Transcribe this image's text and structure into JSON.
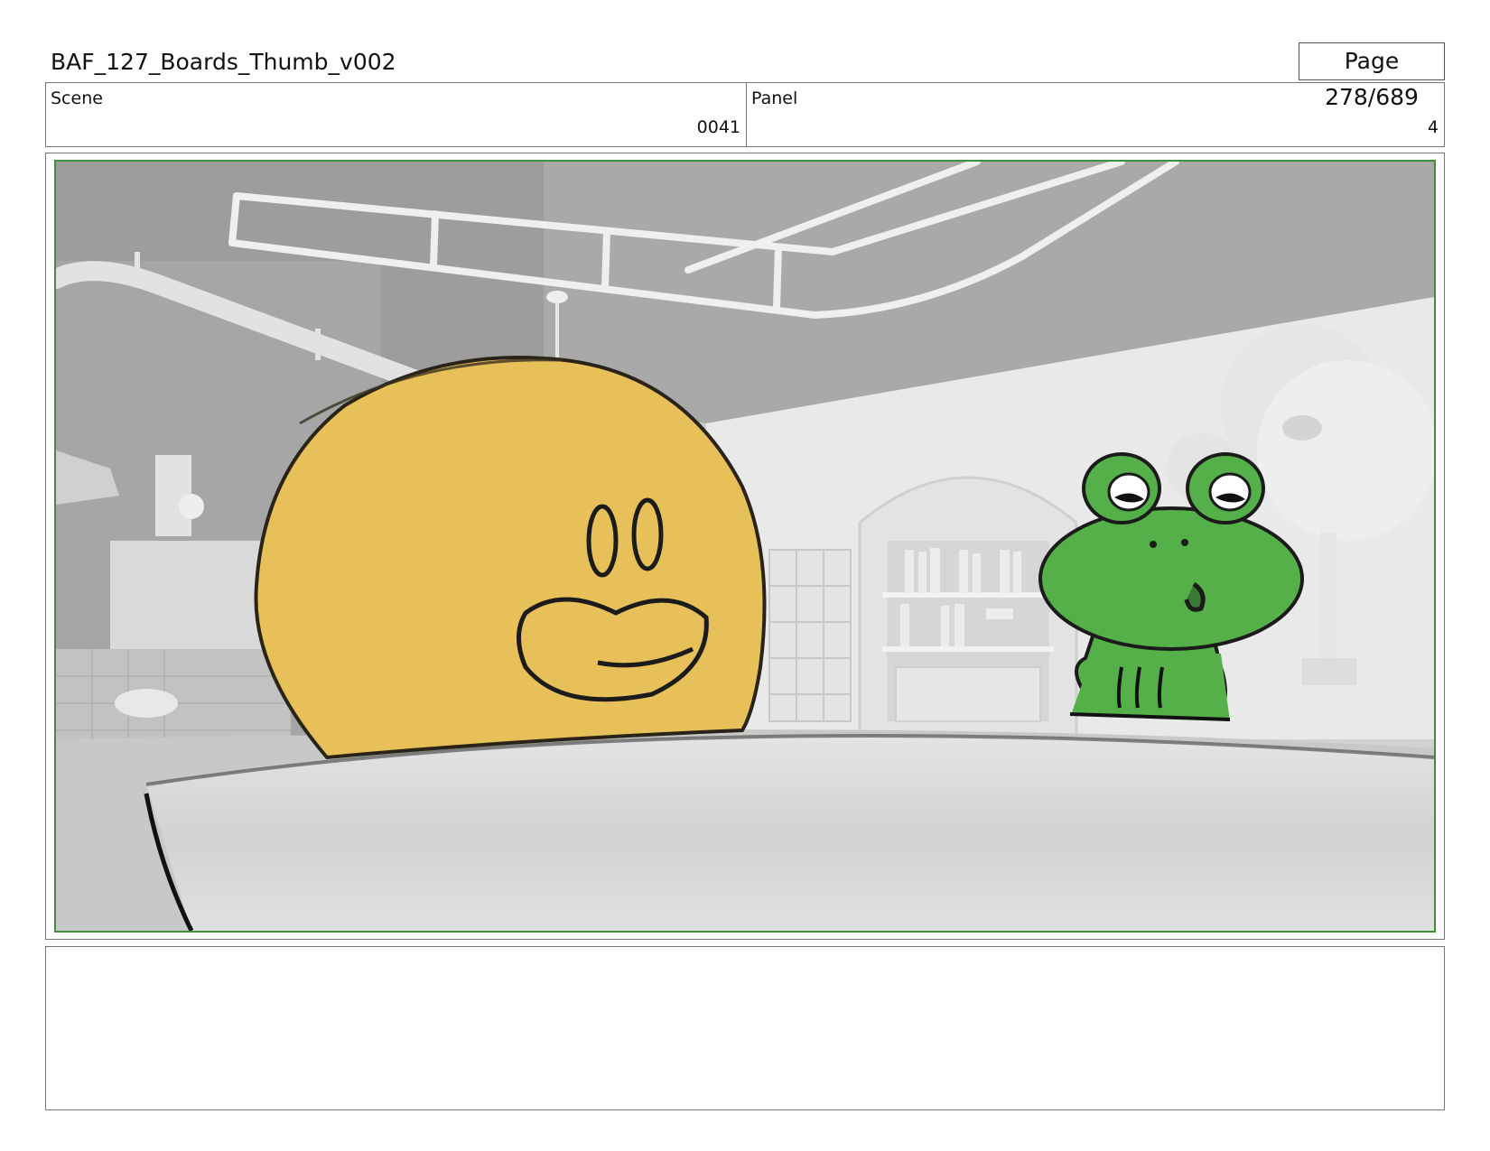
{
  "header": {
    "title": "BAF_127_Boards_Thumb_v002",
    "page": "Page 278/689"
  },
  "meta": {
    "scene_label": "Scene",
    "scene_value": "0041",
    "panel_label": "Panel",
    "panel_value": "4"
  },
  "panel": {
    "characters": [
      "yellow-blob-character",
      "green-frog-character"
    ],
    "colors": {
      "frame_border": "#3f8f3f",
      "blob_fill": "#e8c05a",
      "frog_fill": "#55b04a",
      "background_gray": "#d6d6d6"
    }
  },
  "notes": {
    "text": ""
  }
}
